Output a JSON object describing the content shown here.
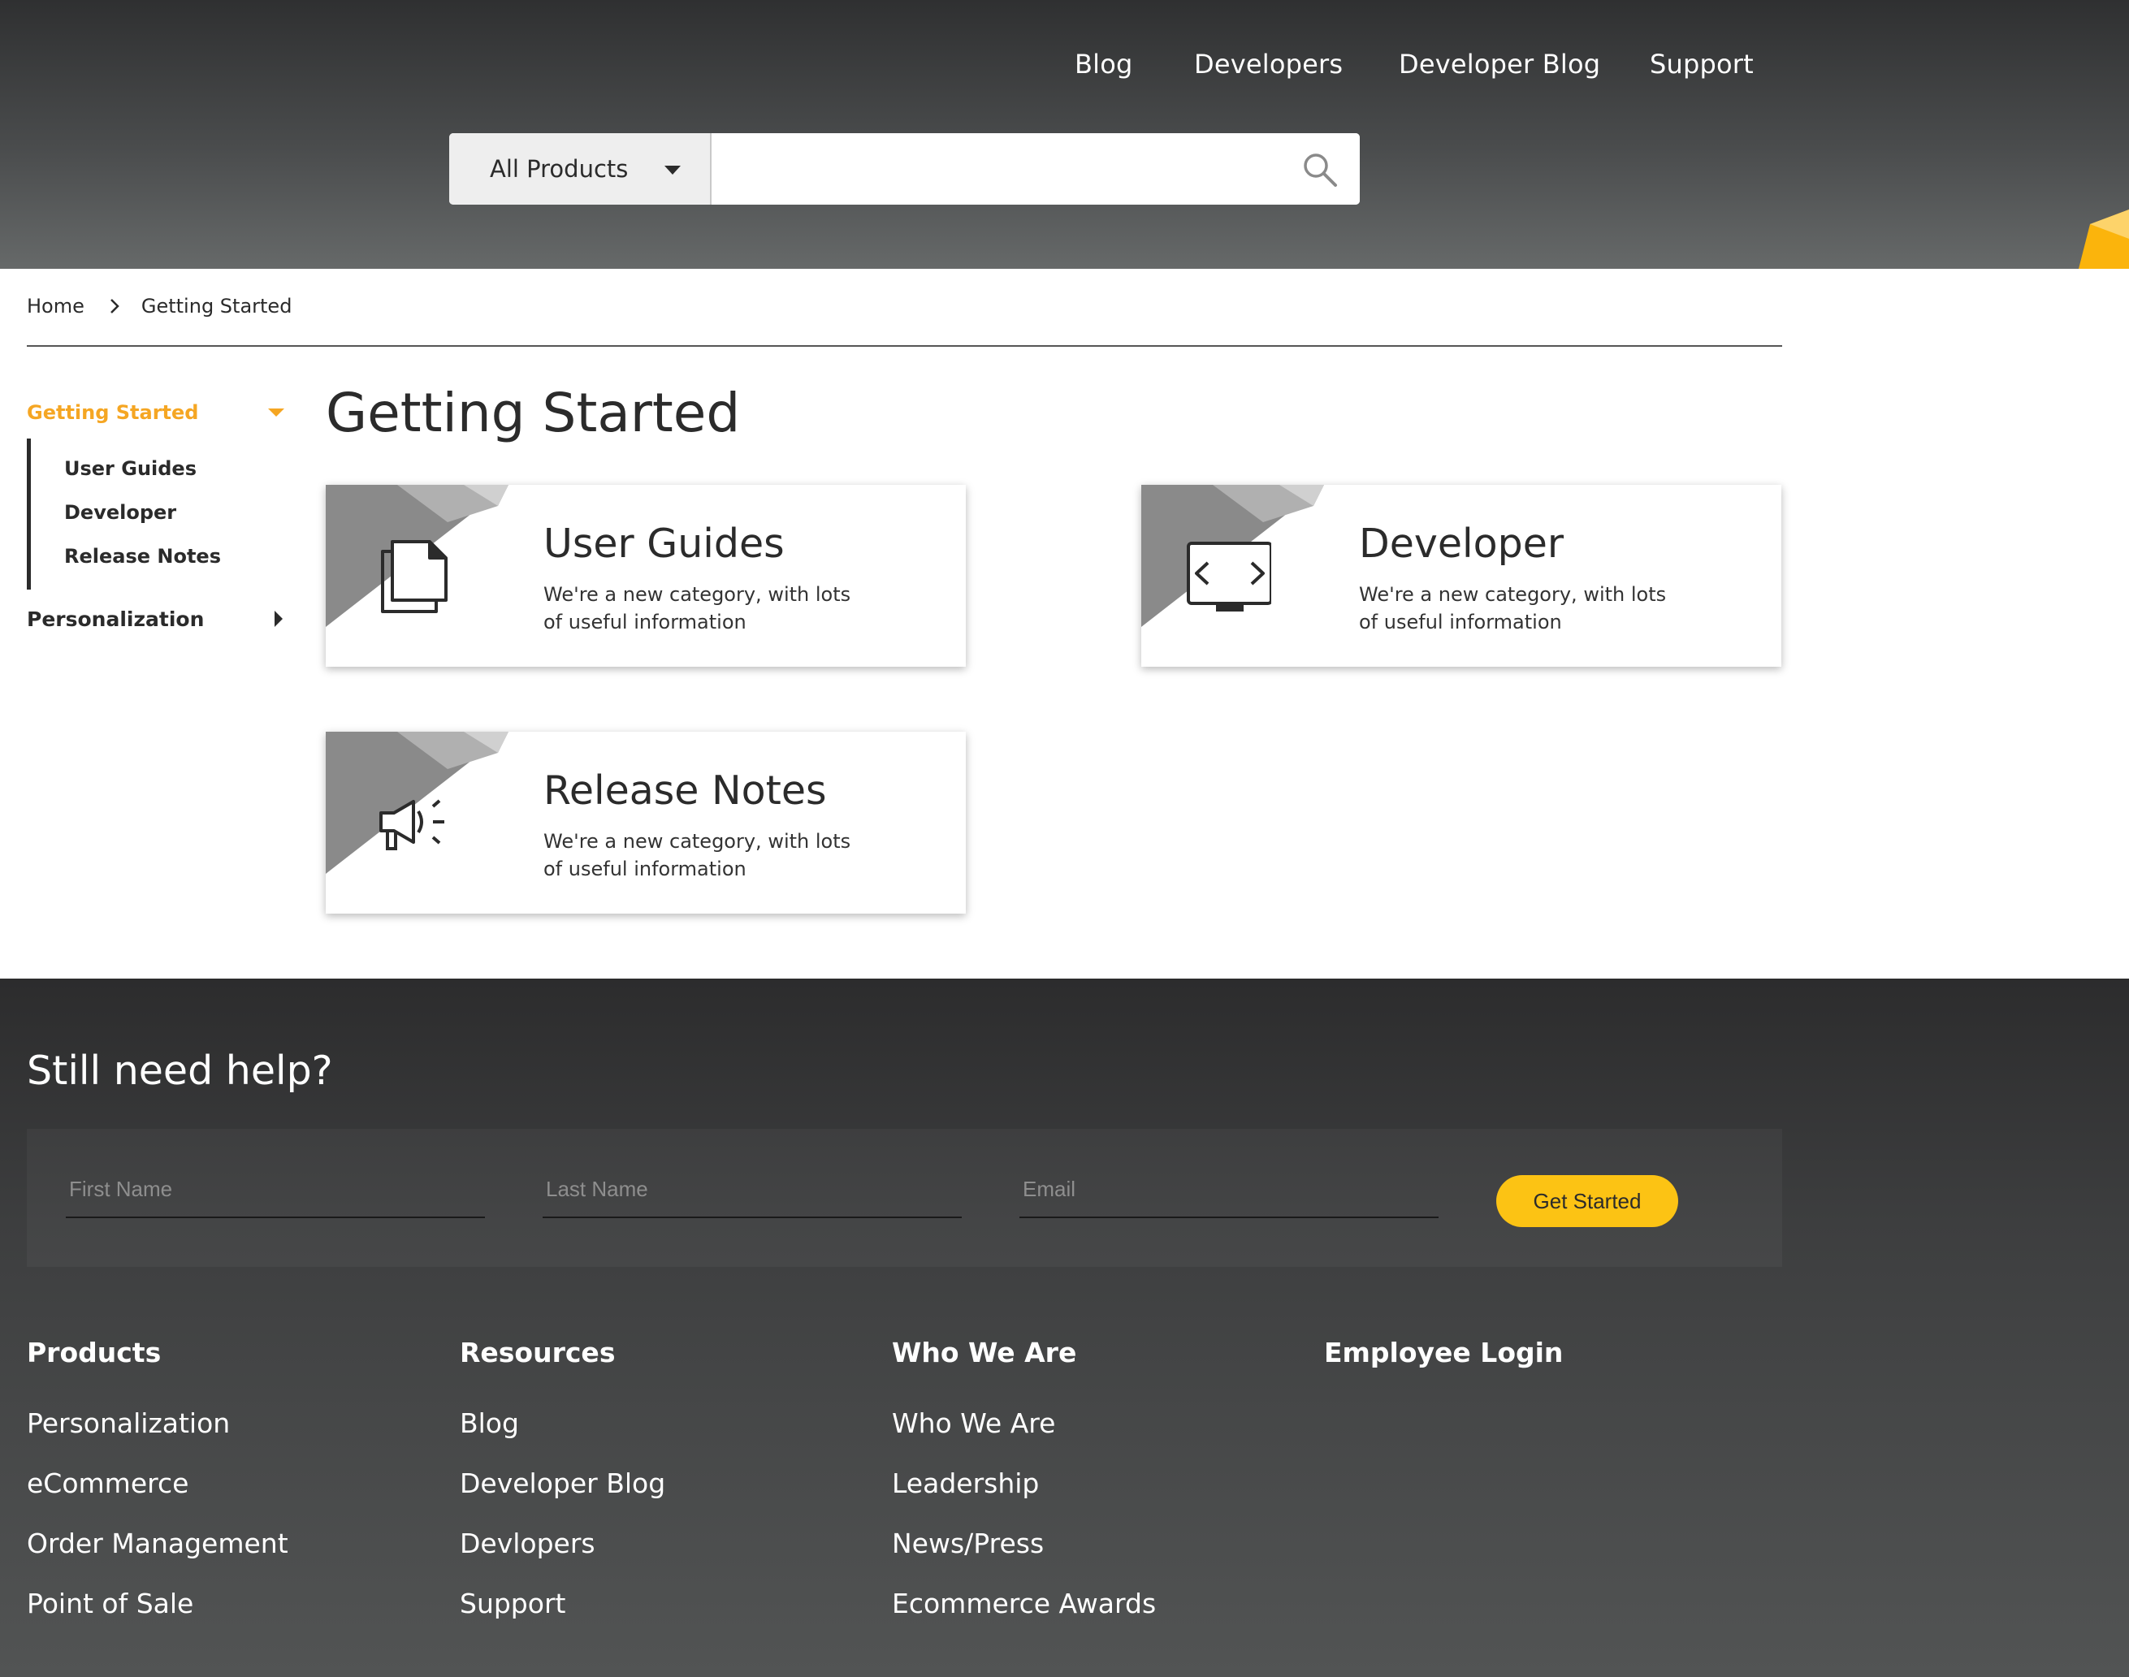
{
  "colors": {
    "accent": "#f5a623",
    "button": "#fcc314",
    "header_dark": "#2f3031",
    "footer_dark": "#2c2c2d"
  },
  "nav": {
    "links": [
      "Blog",
      "Developers",
      "Developer Blog",
      "Support"
    ]
  },
  "search": {
    "product_selected": "All Products",
    "placeholder": "",
    "icon": "search-icon"
  },
  "breadcrumb": {
    "home": "Home",
    "current": "Getting Started"
  },
  "sidebar": {
    "active": "Getting Started",
    "sub_items": [
      "User Guides",
      "Developer",
      "Release Notes"
    ],
    "collapsed": "Personalization"
  },
  "main": {
    "title": "Getting Started",
    "cards": [
      {
        "title": "User Guides",
        "desc": "We're a new category, with lots of useful information",
        "icon": "documents-icon"
      },
      {
        "title": "Developer",
        "desc": "We're a new category, with lots of useful information",
        "icon": "code-monitor-icon"
      },
      {
        "title": "Release Notes",
        "desc": "We're a new category, with lots of useful information",
        "icon": "megaphone-icon"
      }
    ]
  },
  "help": {
    "title": "Still need help?",
    "first_name_placeholder": "First Name",
    "last_name_placeholder": "Last Name",
    "email_placeholder": "Email",
    "button": "Get Started"
  },
  "footer": {
    "columns": [
      {
        "heading": "Products",
        "links": [
          "Personalization",
          "eCommerce",
          "Order Management",
          "Point of Sale"
        ]
      },
      {
        "heading": "Resources",
        "links": [
          "Blog",
          "Developer Blog",
          "Devlopers",
          "Support"
        ]
      },
      {
        "heading": "Who We Are",
        "links": [
          "Who We Are",
          "Leadership",
          "News/Press",
          "Ecommerce Awards"
        ]
      },
      {
        "heading": "Employee Login",
        "links": []
      }
    ]
  }
}
